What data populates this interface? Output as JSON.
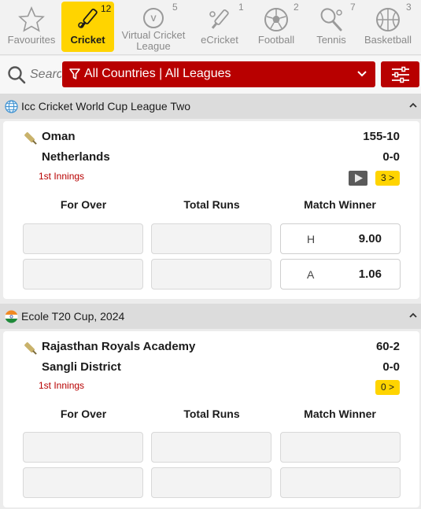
{
  "sports": [
    {
      "label": "Favourites",
      "count": "",
      "icon": "star-icon"
    },
    {
      "label": "Cricket",
      "count": "12",
      "icon": "cricket-icon"
    },
    {
      "label": "Virtual Cricket League",
      "count": "5",
      "icon": "virtual-cricket-icon"
    },
    {
      "label": "eCricket",
      "count": "1",
      "icon": "ecricket-icon"
    },
    {
      "label": "Football",
      "count": "2",
      "icon": "football-icon"
    },
    {
      "label": "Tennis",
      "count": "7",
      "icon": "tennis-icon"
    },
    {
      "label": "Basketball",
      "count": "3",
      "icon": "basketball-icon"
    }
  ],
  "filter": {
    "search_placeholder": "Search",
    "selection": "All Countries | All Leagues"
  },
  "colors": {
    "accent_red": "#b80000",
    "active_yellow": "#ffd400"
  },
  "leagues": [
    {
      "name": "Icc Cricket World Cup League Two",
      "flag": "globe-icon",
      "match": {
        "team1": "Oman",
        "score1": "155-10",
        "team2": "Netherlands",
        "score2": "0-0",
        "status": "1st Innings",
        "more_markets": "3 >",
        "columns": [
          "For Over",
          "Total Runs",
          "Match Winner"
        ],
        "odds": [
          {
            "label": "H",
            "value": "9.00"
          },
          {
            "label": "A",
            "value": "1.06"
          }
        ]
      }
    },
    {
      "name": "Ecole T20 Cup, 2024",
      "flag": "india-flag-icon",
      "match": {
        "team1": "Rajasthan Royals Academy",
        "score1": "60-2",
        "team2": "Sangli District",
        "score2": "0-0",
        "status": "1st Innings",
        "more_markets": "0 >",
        "columns": [
          "For Over",
          "Total Runs",
          "Match Winner"
        ]
      }
    }
  ]
}
